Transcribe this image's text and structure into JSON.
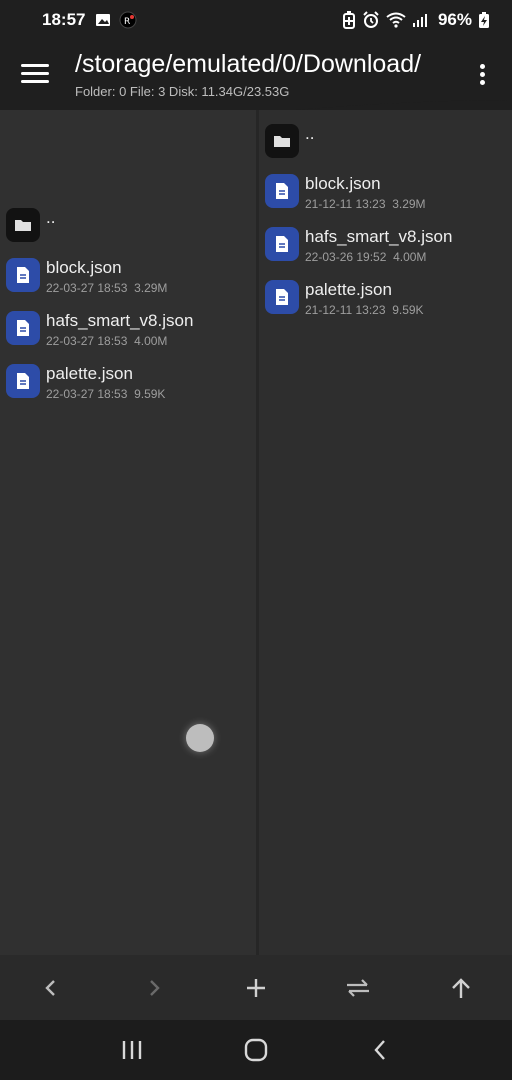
{
  "status_bar": {
    "time": "18:57",
    "battery_percent": "96%"
  },
  "header": {
    "path": "/storage/emulated/0/Download/",
    "info": "Folder: 0  File: 3  Disk: 11.34G/23.53G"
  },
  "left_pane": {
    "up_label": "..",
    "files": [
      {
        "name": "block.json",
        "date": "22-03-27 18:53",
        "size": "3.29M"
      },
      {
        "name": "hafs_smart_v8.json",
        "date": "22-03-27 18:53",
        "size": "4.00M"
      },
      {
        "name": "palette.json",
        "date": "22-03-27 18:53",
        "size": "9.59K"
      }
    ]
  },
  "right_pane": {
    "up_label": "..",
    "files": [
      {
        "name": "block.json",
        "date": "21-12-11 13:23",
        "size": "3.29M"
      },
      {
        "name": "hafs_smart_v8.json",
        "date": "22-03-26 19:52",
        "size": "4.00M"
      },
      {
        "name": "palette.json",
        "date": "21-12-11 13:23",
        "size": "9.59K"
      }
    ]
  },
  "toolbar": {
    "buttons": [
      "back-arrow-icon",
      "forward-arrow-icon",
      "plus-icon",
      "swap-icon",
      "up-arrow-icon"
    ]
  },
  "colors": {
    "file_icon_bg": "#2d4ca8",
    "folder_icon_bg": "#121212",
    "background": "#303030"
  }
}
